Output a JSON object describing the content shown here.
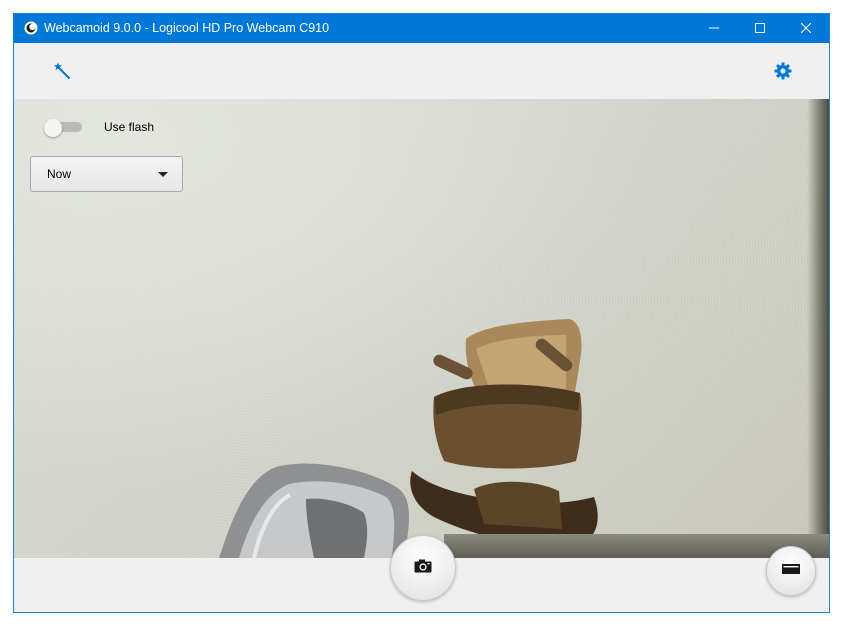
{
  "window": {
    "title": "Webcamoid 9.0.0 - Logicool HD Pro Webcam C910",
    "app_icon": "webcamoid-app-icon",
    "controls": [
      "minimize-icon",
      "maximize-icon",
      "close-icon"
    ]
  },
  "toolbar": {
    "effects_icon": "magic-wand-icon",
    "settings_icon": "gear-icon"
  },
  "overlay": {
    "flash_label": "Use flash",
    "flash_enabled": false,
    "timer_value": "Now",
    "timer_icon": "caret-down-icon"
  },
  "bottombar": {
    "capture_icon": "camera-icon",
    "mode_icon": "video-mode-icon"
  },
  "colors": {
    "titlebar": "#0078d7",
    "accent": "#1883d7"
  }
}
